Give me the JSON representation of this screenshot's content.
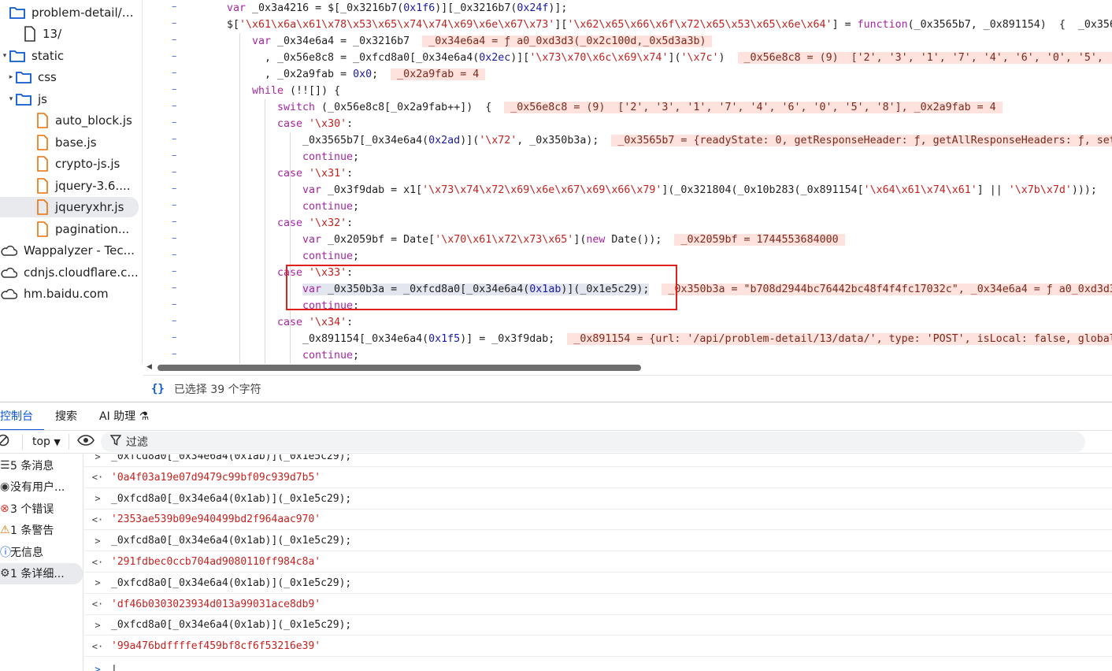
{
  "sidebar": {
    "items": [
      {
        "label": "problem-detail/…",
        "icon": "folder-icon",
        "arrow": ""
      },
      {
        "label": "13/",
        "icon": "file-icon",
        "arrow": ""
      },
      {
        "label": "static",
        "icon": "folder-icon",
        "arrow": "▾"
      },
      {
        "label": "css",
        "icon": "folder-icon",
        "arrow": "▸"
      },
      {
        "label": "js",
        "icon": "folder-icon",
        "arrow": "▾"
      },
      {
        "label": "auto_block.js",
        "icon": "js-file-icon",
        "arrow": ""
      },
      {
        "label": "base.js",
        "icon": "js-file-icon",
        "arrow": ""
      },
      {
        "label": "crypto-js.js",
        "icon": "js-file-icon",
        "arrow": ""
      },
      {
        "label": "jquery-3.6....",
        "icon": "js-file-icon",
        "arrow": ""
      },
      {
        "label": "jqueryxhr.js",
        "icon": "js-file-icon",
        "arrow": "",
        "selected": true
      },
      {
        "label": "pagination...",
        "icon": "js-file-icon",
        "arrow": ""
      },
      {
        "label": "Wappalyzer - Tec...",
        "icon": "cloud-icon",
        "arrow": ""
      },
      {
        "label": "cdnjs.cloudflare.c...",
        "icon": "cloud-icon",
        "arrow": ""
      },
      {
        "label": "hm.baidu.com",
        "icon": "cloud-icon",
        "arrow": ""
      }
    ]
  },
  "editor": {
    "lines": [
      "var _0x3a4216 = $[_0x3216b7(0x1f6)][_0x3216b7(0x24f)];",
      "$['\\x61\\x6a\\x61\\x78\\x53\\x65\\x74\\x74\\x69\\x6e\\x67\\x73']['\\x62\\x65\\x66\\x6f\\x72\\x65\\x53\\x65\\x6e\\x64'] = function(_0x3565b7, _0x891154)  {  _0x356",
      "var _0x34e6a4 = _0x3216b7",
      ", _0x56e8c8 = _0xfcd8a0[_0x34e6a4(0x2ec)]['\\x73\\x70\\x6c\\x69\\x74']('\\x7c')",
      ", _0x2a9fab = 0x0;",
      "while (!![]) {",
      "switch (_0x56e8c8[_0x2a9fab++])  {",
      "case '\\x30':",
      "_0x3565b7[_0x34e6a4(0x2ad)]('\\x72', _0x350b3a);",
      "continue;",
      "case '\\x31':",
      "var _0x3f9dab = x1['\\x73\\x74\\x72\\x69\\x6e\\x67\\x69\\x66\\x79'](_0x321804(_0x10b283(_0x891154['\\x64\\x61\\x74\\x61'] || '\\x7b\\x7d')));",
      "continue;",
      "case '\\x32':",
      "var _0x2059bf = Date['\\x70\\x61\\x72\\x73\\x65'](new Date());",
      "continue;",
      "case '\\x33':",
      "var _0x350b3a = _0xfcd8a0[_0x34e6a4(0x1ab)](_0x1e5c29);",
      "continue;",
      "case '\\x34':",
      "_0x891154[_0x34e6a4(0x1f5)] = _0x3f9dab;",
      "continue;"
    ],
    "inline_values": [
      "",
      "",
      "_0x34e6a4 = ƒ a0_0xd3d3(_0x2c100d,_0x5d3a3b)",
      "_0x56e8c8 = (9)  ['2', '3', '1', '7', '4', '6', '0', '5', '",
      "_0x2a9fab = 4",
      "",
      "_0x56e8c8 = (9)  ['2', '3', '1', '7', '4', '6', '0', '5', '8'], _0x2a9fab = 4",
      "",
      "_0x3565b7 = {readyState: 0, getResponseHeader: ƒ, getAllResponseHeaders: ƒ, set",
      "",
      "",
      "",
      "",
      "",
      "_0x2059bf = 1744553684000",
      "",
      "",
      "_0x350b3a = \"b708d2944bc76442bc48f4f4fc17032c\", _0x34e6a4 = ƒ a0_0xd3d3",
      "",
      "",
      "_0x891154 = {url: '/api/problem-detail/13/data/', type: 'POST', isLocal: false, global",
      ""
    ]
  },
  "status": {
    "text": "已选择 39 个字符"
  },
  "tabs": [
    "控制台",
    "搜索",
    "AI 助理"
  ],
  "toolbar": {
    "context": "top",
    "filter_placeholder": "过滤"
  },
  "console_side": [
    "5 条消息",
    "没有用户...",
    "3 个错误",
    "1 条警告",
    "无信息",
    "1 条详细..."
  ],
  "console": {
    "truncated": "_0xfcd8a0[_0x34e6a4(0x1ab)](_0x1e5c29);",
    "entries": [
      {
        "input": "",
        "output": "'0a4f03a19e07d9479c99bf09c939d7b5'"
      },
      {
        "input": "_0xfcd8a0[_0x34e6a4(0x1ab)](_0x1e5c29);",
        "output": "'2353ae539b09e940499bd2f964aac970'"
      },
      {
        "input": "_0xfcd8a0[_0x34e6a4(0x1ab)](_0x1e5c29);",
        "output": "'291fdbec0ccb704ad9080110ff984c8a'"
      },
      {
        "input": "_0xfcd8a0[_0x34e6a4(0x1ab)](_0x1e5c29);",
        "output": "'df46b0303023934d013a99031ace8db9'"
      },
      {
        "input": "_0xfcd8a0[_0x34e6a4(0x1ab)](_0x1e5c29);",
        "output": "'99a476bdffffef459bf8cf6f53216e39'"
      }
    ]
  }
}
